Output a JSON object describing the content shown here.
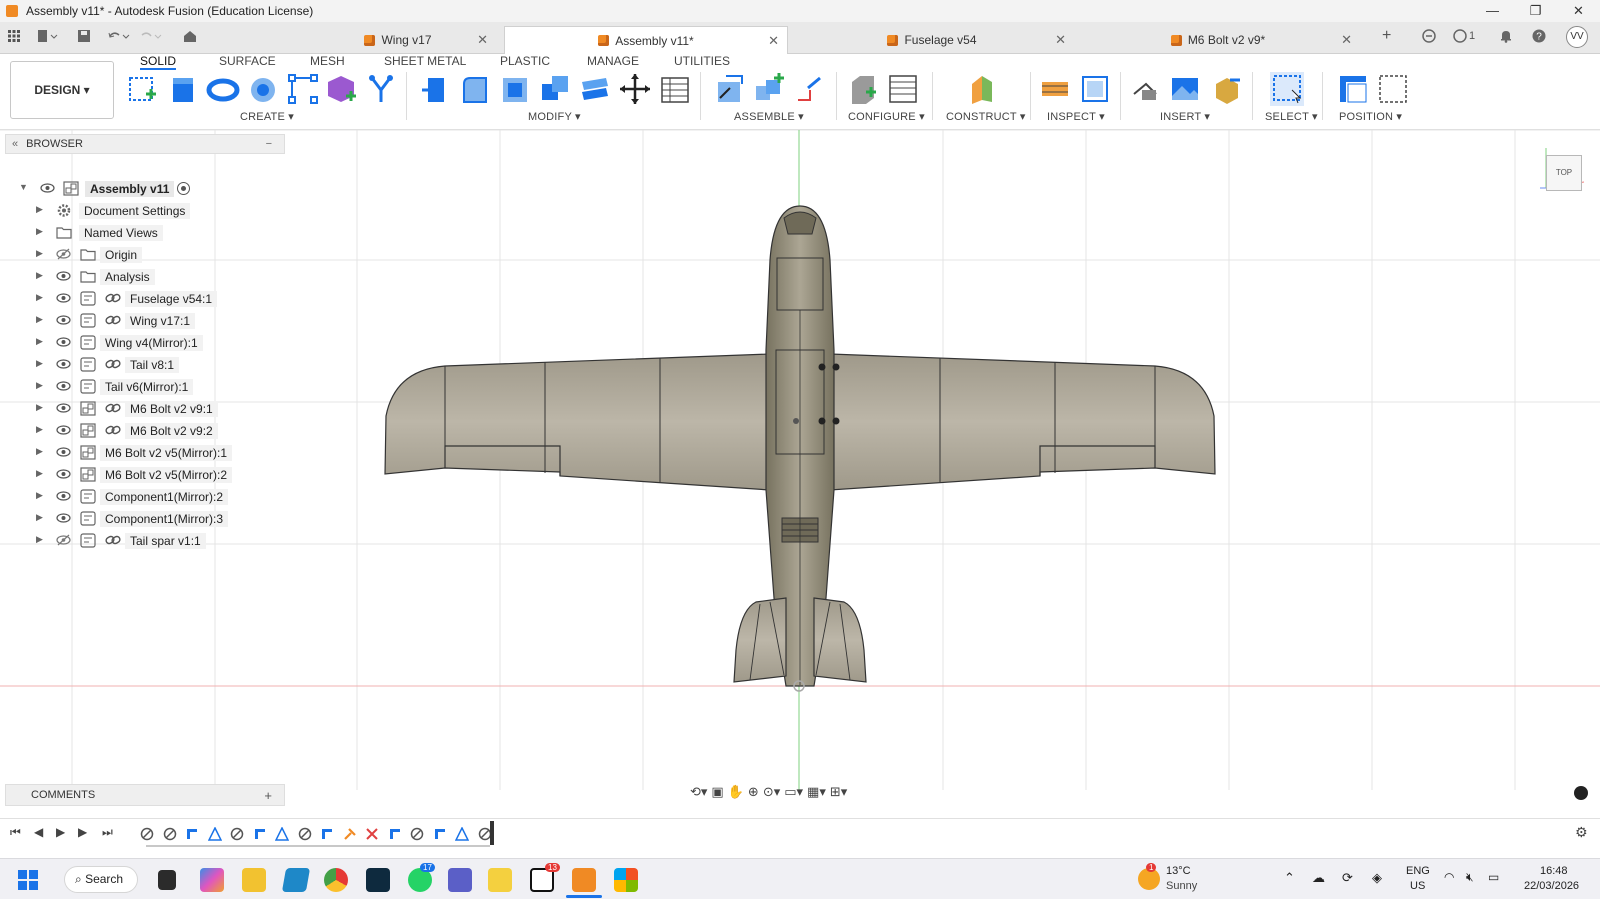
{
  "window": {
    "title": "Assembly v11* - Autodesk Fusion (Education License)",
    "controls": [
      "—",
      "❐",
      "✕"
    ]
  },
  "tabs": [
    {
      "label": "Wing v17"
    },
    {
      "label": "Assembly v11*"
    },
    {
      "label": "Fuselage v54"
    },
    {
      "label": "M6 Bolt v2 v9*"
    }
  ],
  "header_right": {
    "jobs_count": "1",
    "avatar": "VV"
  },
  "toolbar": {
    "workspace": "DESIGN",
    "workspace_tabs": [
      "SOLID",
      "SURFACE",
      "MESH",
      "SHEET METAL",
      "PLASTIC",
      "MANAGE",
      "UTILITIES"
    ],
    "groups": [
      "CREATE",
      "MODIFY",
      "ASSEMBLE",
      "CONFIGURE",
      "CONSTRUCT",
      "INSPECT",
      "INSERT",
      "SELECT",
      "POSITION"
    ]
  },
  "browser": {
    "title": "BROWSER",
    "items": [
      {
        "label": "Assembly v11",
        "icon": "assembly-icon"
      },
      {
        "label": "Document Settings",
        "icon": "gear-icon"
      },
      {
        "label": "Named Views",
        "icon": "folder-icon"
      },
      {
        "label": "Origin",
        "icon": "folder-icon",
        "hidden": true
      },
      {
        "label": "Analysis",
        "icon": "folder-icon"
      },
      {
        "label": "Fuselage v54:1",
        "icon": "component-icon",
        "linked": true
      },
      {
        "label": "Wing v17:1",
        "icon": "component-icon",
        "linked": true
      },
      {
        "label": "Wing v4(Mirror):1",
        "icon": "component-icon"
      },
      {
        "label": "Tail v8:1",
        "icon": "component-icon",
        "linked": true
      },
      {
        "label": "Tail v6(Mirror):1",
        "icon": "component-icon"
      },
      {
        "label": "M6 Bolt v2 v9:1",
        "icon": "assembly-icon",
        "linked": true
      },
      {
        "label": "M6 Bolt v2 v9:2",
        "icon": "assembly-icon",
        "linked": true
      },
      {
        "label": "M6 Bolt v2 v5(Mirror):1",
        "icon": "assembly-icon"
      },
      {
        "label": "M6 Bolt v2 v5(Mirror):2",
        "icon": "assembly-icon"
      },
      {
        "label": "Component1(Mirror):2",
        "icon": "component-icon"
      },
      {
        "label": "Component1(Mirror):3",
        "icon": "component-icon"
      },
      {
        "label": "Tail spar v1:1",
        "icon": "component-icon",
        "linked": true,
        "hidden": true
      }
    ]
  },
  "viewcube": {
    "face": "TOP"
  },
  "comments": {
    "title": "COMMENTS"
  },
  "taskbar": {
    "search": "Search",
    "weather_temp": "13°C",
    "weather_desc": "Sunny",
    "weather_badge": "1",
    "whatsapp_badge": "17",
    "notion_badge": "13",
    "lang_1": "ENG",
    "lang_2": "US",
    "time": "16:48",
    "date": "22/03/2026"
  },
  "colors": {
    "accent": "#1a73e8",
    "fusion_orange": "#f08a24",
    "model": "#a09a8c",
    "grid": "#e3e3e3"
  }
}
